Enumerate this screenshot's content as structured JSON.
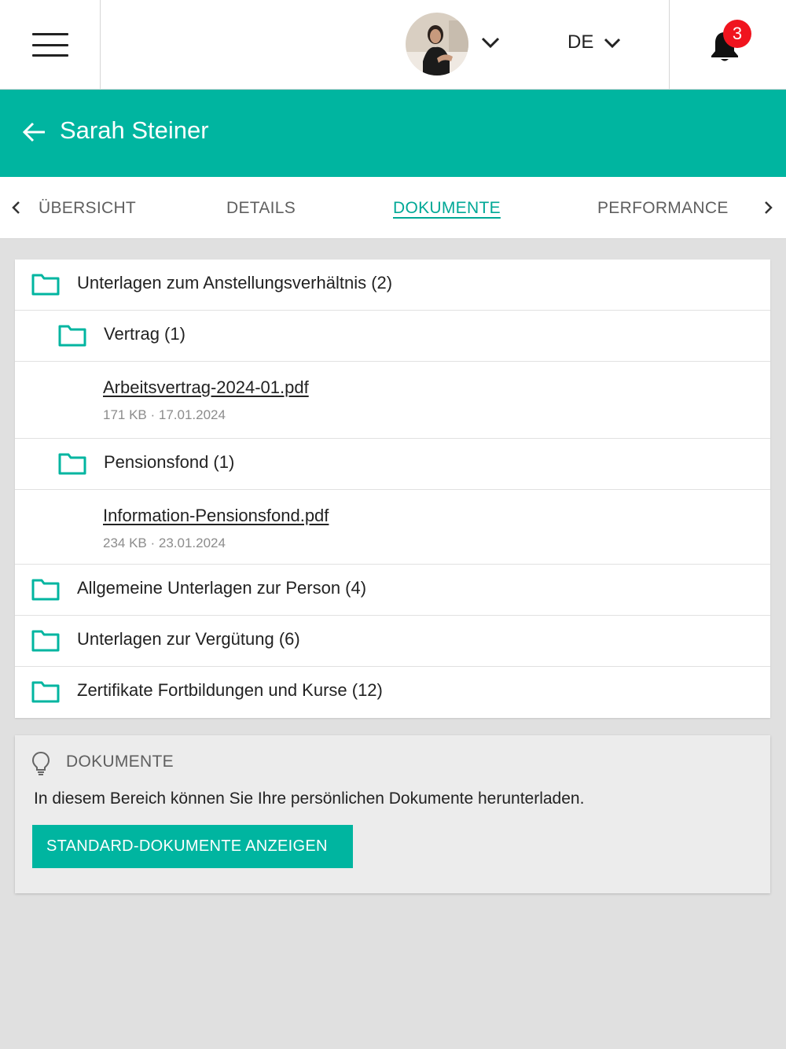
{
  "topbar": {
    "menu_icon": "hamburger-icon",
    "avatar_alt": "user-avatar",
    "language": "DE",
    "notifications_count": "3"
  },
  "header": {
    "title": "Sarah Steiner"
  },
  "tabs": [
    {
      "label": "ÜBERSICHT",
      "active": false
    },
    {
      "label": "DETAILS",
      "active": false
    },
    {
      "label": "DOKUMENTE",
      "active": true
    },
    {
      "label": "PERFORMANCE",
      "active": false
    }
  ],
  "documents": {
    "folders": [
      {
        "name": "Unterlagen zum Anstellungsverhältnis (2)",
        "subfolders": [
          {
            "name": "Vertrag (1)",
            "files": [
              {
                "name": "Arbeitsvertrag-2024-01.pdf",
                "meta": "171 KB · 17.01.2024"
              }
            ]
          },
          {
            "name": "Pensionsfond (1)",
            "files": [
              {
                "name": "Information-Pensionsfond.pdf",
                "meta": "234 KB · 23.01.2024"
              }
            ]
          }
        ]
      },
      {
        "name": "Allgemeine Unterlagen zur Person (4)"
      },
      {
        "name": "Unterlagen zur Vergütung (6)"
      },
      {
        "name": "Zertifikate Fortbildungen und Kurse (12)"
      }
    ]
  },
  "info": {
    "title": "DOKUMENTE",
    "text": "In diesem Bereich können Sie Ihre persönlichen Dokumente herunterladen.",
    "button": "STANDARD-DOKUMENTE ANZEIGEN"
  },
  "colors": {
    "accent": "#00b5a0",
    "badge": "#f0141e"
  }
}
